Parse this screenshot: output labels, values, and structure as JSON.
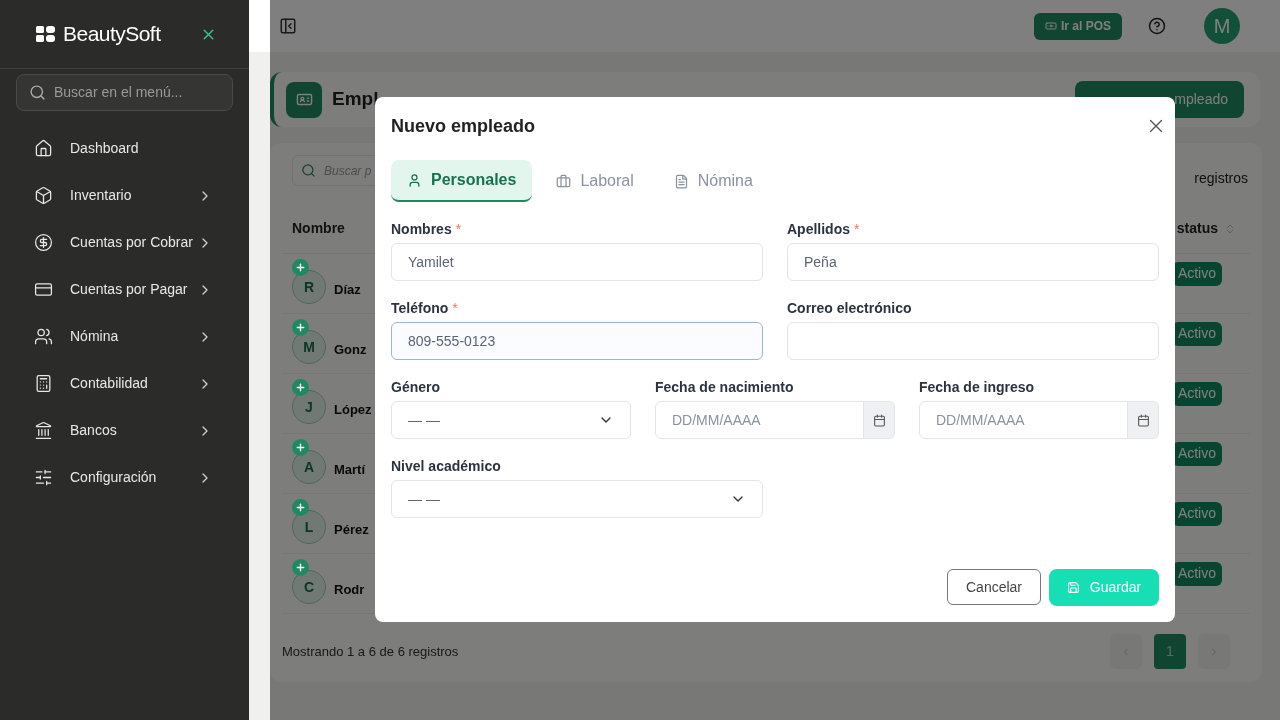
{
  "sidebar": {
    "brand": "BeautySoft",
    "search_placeholder": "Buscar en el menú...",
    "items": [
      {
        "label": "Dashboard",
        "expandable": false
      },
      {
        "label": "Inventario",
        "expandable": true
      },
      {
        "label": "Cuentas por Cobrar",
        "expandable": true
      },
      {
        "label": "Cuentas por Pagar",
        "expandable": true
      },
      {
        "label": "Nómina",
        "expandable": true
      },
      {
        "label": "Contabilidad",
        "expandable": true
      },
      {
        "label": "Bancos",
        "expandable": true
      },
      {
        "label": "Configuración",
        "expandable": true
      }
    ]
  },
  "header": {
    "pos_button": "Ir al POS",
    "avatar": "M"
  },
  "page": {
    "title": "Empl",
    "new_button": "mpleado",
    "search_placeholder": "Buscar p",
    "page_size_label": "registros",
    "columns": [
      "Nombre",
      "status"
    ],
    "rows": [
      {
        "initial": "R",
        "name": "Díaz",
        "status": "Activo"
      },
      {
        "initial": "M",
        "name": "Gonz",
        "status": "Activo"
      },
      {
        "initial": "J",
        "name": "López",
        "status": "Activo"
      },
      {
        "initial": "A",
        "name": "Martí",
        "status": "Activo"
      },
      {
        "initial": "L",
        "name": "Pérez",
        "status": "Activo"
      },
      {
        "initial": "C",
        "name": "Rodr",
        "status": "Activo"
      }
    ],
    "footer": "Mostrando 1 a 6 de 6 registros",
    "pages": [
      {
        "label": "1",
        "selected": true
      }
    ]
  },
  "dialog": {
    "title": "Nuevo empleado",
    "tabs": [
      {
        "label": "Personales",
        "selected": true
      },
      {
        "label": "Laboral",
        "selected": false
      },
      {
        "label": "Nómina",
        "selected": false
      }
    ],
    "rows": [
      [
        {
          "label": "Nombres",
          "required_mark": "*",
          "kind": "text",
          "value": "Yamilet",
          "focused": false
        },
        {
          "label": "Apellidos",
          "required_mark": "*",
          "kind": "text",
          "value": "Peña",
          "focused": false
        }
      ],
      [
        {
          "label": "Teléfono",
          "required_mark": "*",
          "kind": "text",
          "value": "809-555-0123",
          "focused": true
        },
        {
          "label": "Correo electrónico",
          "kind": "text",
          "focused": false
        }
      ],
      [
        {
          "label": "Género",
          "kind": "select",
          "value": "— —",
          "focused": false
        },
        {
          "label": "Fecha de nacimiento",
          "kind": "date",
          "placeholder": "DD/MM/AAAA",
          "focused": false
        },
        {
          "label": "Fecha de ingreso",
          "kind": "date",
          "placeholder": "DD/MM/AAAA",
          "focused": false
        }
      ],
      [
        {
          "label": "Nivel académico",
          "kind": "select",
          "value": "— —",
          "focused": false
        }
      ]
    ],
    "cancel_button": "Cancelar",
    "save_button": "Guardar"
  }
}
